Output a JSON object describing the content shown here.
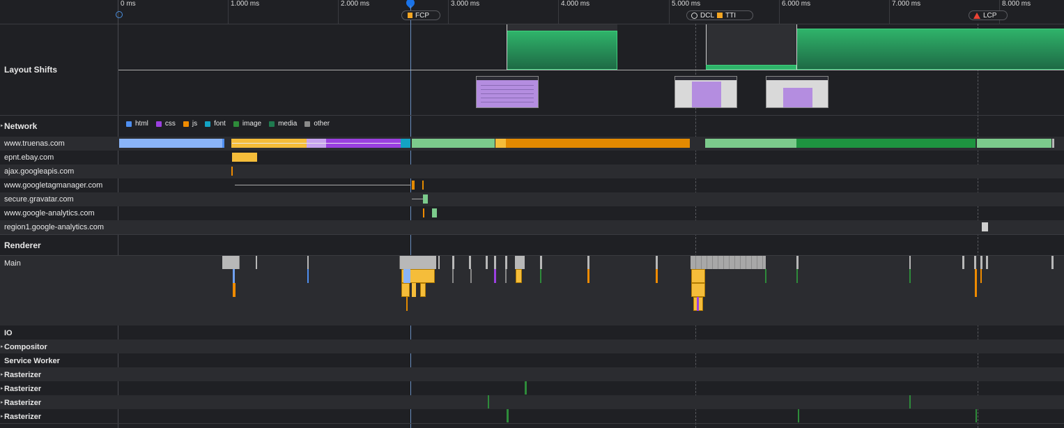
{
  "ticks": [
    "0 ms",
    "1.000 ms",
    "2.000 ms",
    "3.000 ms",
    "4.000 ms",
    "5.000 ms",
    "6.000 ms",
    "7.000 ms",
    "8.000 ms"
  ],
  "markers": {
    "fcp": "FCP",
    "dcl": "DCL",
    "tti": "TTI",
    "lcp": "LCP"
  },
  "sections": {
    "layout_shifts": "Layout Shifts",
    "network": "Network",
    "renderer": "Renderer",
    "main": "Main",
    "io": "IO",
    "compositor": "Compositor",
    "service_worker": "Service Worker",
    "rasterizer": "Rasterizer"
  },
  "legend": [
    {
      "label": "html",
      "color": "#4f8ff0"
    },
    {
      "label": "css",
      "color": "#9b40e0"
    },
    {
      "label": "js",
      "color": "#ef8b00"
    },
    {
      "label": "font",
      "color": "#13a3c4"
    },
    {
      "label": "image",
      "color": "#2e8b3a"
    },
    {
      "label": "media",
      "color": "#1f7a4f"
    },
    {
      "label": "other",
      "color": "#8a8a8a"
    }
  ],
  "hosts": [
    "www.truenas.com",
    "epnt.ebay.com",
    "ajax.googleapis.com",
    "www.googletagmanager.com",
    "secure.gravatar.com",
    "www.google-analytics.com",
    "region1.google-analytics.com"
  ],
  "colors": {
    "background": "#1f2024",
    "row_alt": "#2b2c30",
    "html": "#8ab4f8",
    "css": "#a857e8",
    "js": "#f5bd3a",
    "js_dark": "#e38a00",
    "image": "#7ccb8c",
    "image_dark": "#1e9440",
    "other": "#b8b8b8",
    "layout_green": "#2fb36a",
    "fcp_line": "#4a8fe0",
    "lcp": "#ea4335"
  }
}
